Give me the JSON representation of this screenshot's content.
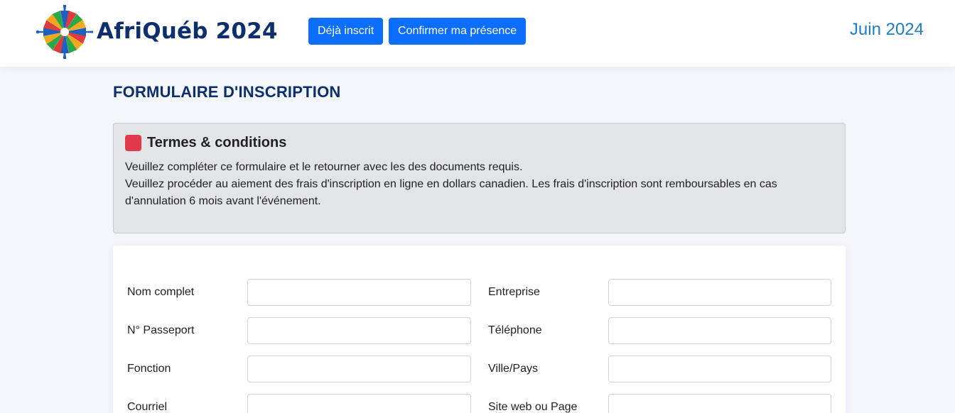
{
  "header": {
    "brand": "AfriQuéb 2024",
    "buttons": {
      "already_registered": "Déjà inscrit",
      "confirm_presence": "Confirmer ma présence"
    },
    "date": "Juin 2024"
  },
  "page_title": "FORMULAIRE D'INSCRIPTION",
  "terms": {
    "title": "Termes & conditions",
    "line1": "Veuillez compléter ce formulaire et le retourner avec les des documents requis.",
    "line2": "Veuillez procéder au aiement des frais d'inscription en ligne en dollars canadien. Les frais d'inscription sont remboursables en cas d'annulation 6 mois avant l'événement."
  },
  "form": {
    "rows": [
      {
        "left_label": "Nom complet",
        "right_label": "Entreprise"
      },
      {
        "left_label": "N° Passeport",
        "right_label": "Téléphone"
      },
      {
        "left_label": "Fonction",
        "right_label": "Ville/Pays"
      },
      {
        "left_label": "Courriel",
        "right_label": "Site web ou Page"
      }
    ]
  },
  "colors": {
    "primary_button": "#0d6efd",
    "brand_navy": "#0d2f6d",
    "date_blue": "#1d7fc2",
    "terms_icon": "#e0394a"
  },
  "icons": {
    "logo": "compass-star-logo-icon",
    "terms": "red-square-icon"
  }
}
